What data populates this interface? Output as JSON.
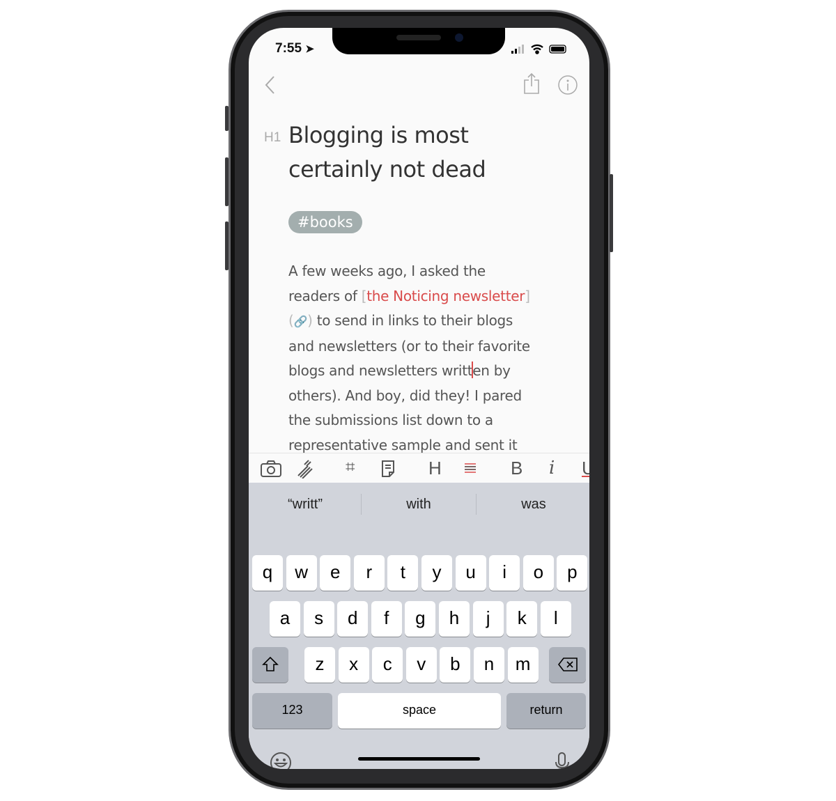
{
  "status": {
    "time": "7:55"
  },
  "nav": {
    "back": "back-icon",
    "share": "share-icon",
    "info": "info-icon"
  },
  "note": {
    "heading_marker": "H1",
    "title_lines": [
      "Blogging is most",
      "certainly not dead"
    ],
    "tag": "#books",
    "body": {
      "l1": "A few weeks ago, I asked the",
      "l2a": "readers of ",
      "l2b": "[",
      "l2c": "the Noticing newsletter",
      "l2d": "]",
      "l3a": "(",
      "l3b": "🔗",
      "l3c": ")",
      "l3d": " to send in links to their blogs",
      "l4": "and newsletters (or to their favorite",
      "l5a": "blogs and newsletters writt",
      "l5b": "en by",
      "l6": "others). And boy, did they! I pared",
      "l7": "the submissions list down to a",
      "l8": "representative sample and sent it"
    }
  },
  "toolbar": {
    "heading": "H",
    "bold": "B",
    "italic": "i",
    "underline": "U",
    "accent": "#d94b4b"
  },
  "keyboard": {
    "suggestions": [
      "“writt”",
      "with",
      "was"
    ],
    "row1": [
      "q",
      "w",
      "e",
      "r",
      "t",
      "y",
      "u",
      "i",
      "o",
      "p"
    ],
    "row2": [
      "a",
      "s",
      "d",
      "f",
      "g",
      "h",
      "j",
      "k",
      "l"
    ],
    "row3": [
      "z",
      "x",
      "c",
      "v",
      "b",
      "n",
      "m"
    ],
    "numbers": "123",
    "space": "space",
    "return": "return"
  }
}
